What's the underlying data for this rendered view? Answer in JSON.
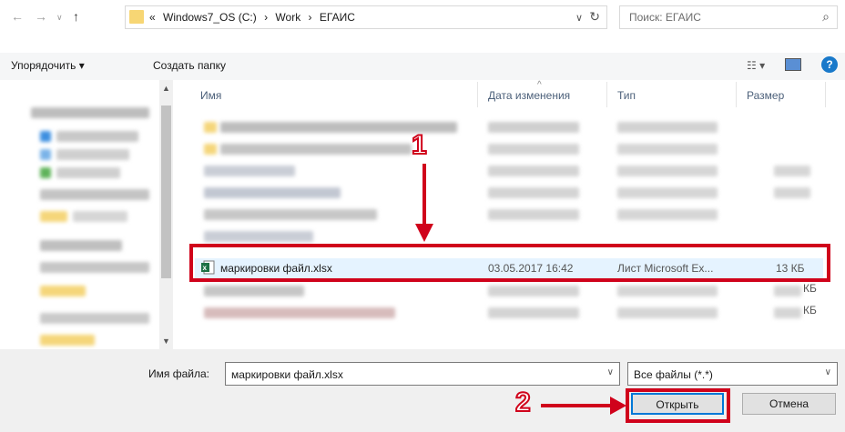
{
  "address": {
    "overflow": "«",
    "crumbs": [
      "Windows7_OS (C:)",
      "Work",
      "ЕГАИС"
    ],
    "separator": "›"
  },
  "search": {
    "placeholder": "Поиск: ЕГАИС"
  },
  "toolbar": {
    "organize": "Упорядочить ▾",
    "new_folder": "Создать папку"
  },
  "columns": {
    "name": "Имя",
    "date": "Дата изменения",
    "type": "Тип",
    "size": "Размер"
  },
  "selected_file": {
    "name": "маркировки файл.xlsx",
    "date": "03.05.2017 16:42",
    "type": "Лист Microsoft Ex...",
    "size": "13 КБ"
  },
  "partial_sizes": [
    "КБ",
    "КБ"
  ],
  "bottom": {
    "filename_label": "Имя файла:",
    "filename_value": "маркировки файл.xlsx",
    "filter_value": "Все файлы (*.*)",
    "open_label": "Открыть",
    "cancel_label": "Отмена"
  },
  "annotations": {
    "marker1": "1",
    "marker2": "2"
  },
  "colors": {
    "highlight": "#d0021b",
    "selection": "#e5f3ff",
    "accent": "#0078d7"
  }
}
